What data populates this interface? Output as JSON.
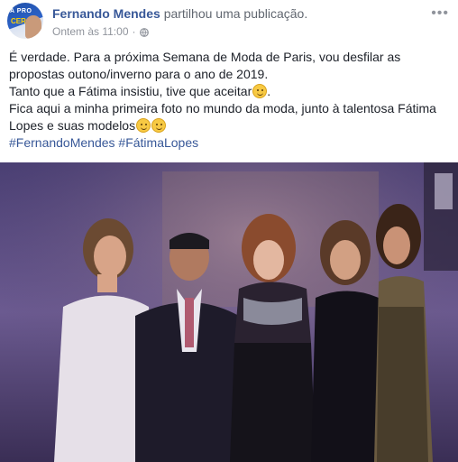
{
  "post": {
    "author": "Fernando Mendes",
    "action": "partilhou uma publicação.",
    "timestamp": "Ontem às 11:00",
    "separator": "·",
    "avatar_text_top": "A PRO",
    "avatar_text_bottom": "CER",
    "text_lines": [
      "É verdade. Para a próxima Semana de Moda de Paris, vou desfilar as",
      "propostas outono/inverno para o ano de 2019.",
      "Tanto que a Fátima insistiu, tive que aceitar",
      "Fica aqui a minha primeira foto no mundo da moda, junto à talentosa Fátima",
      "Lopes e suas modelos"
    ],
    "hashtags": "#FernandoMendes #FátimaLopes",
    "more_icon": "•••"
  },
  "icons": {
    "globe": "globe-icon",
    "more": "more-options-icon",
    "emoji": "smiley-emoji-icon"
  },
  "colors": {
    "link": "#385898",
    "text": "#1d2129",
    "meta": "#90949c",
    "photo_bg": "#4b3d6e"
  }
}
